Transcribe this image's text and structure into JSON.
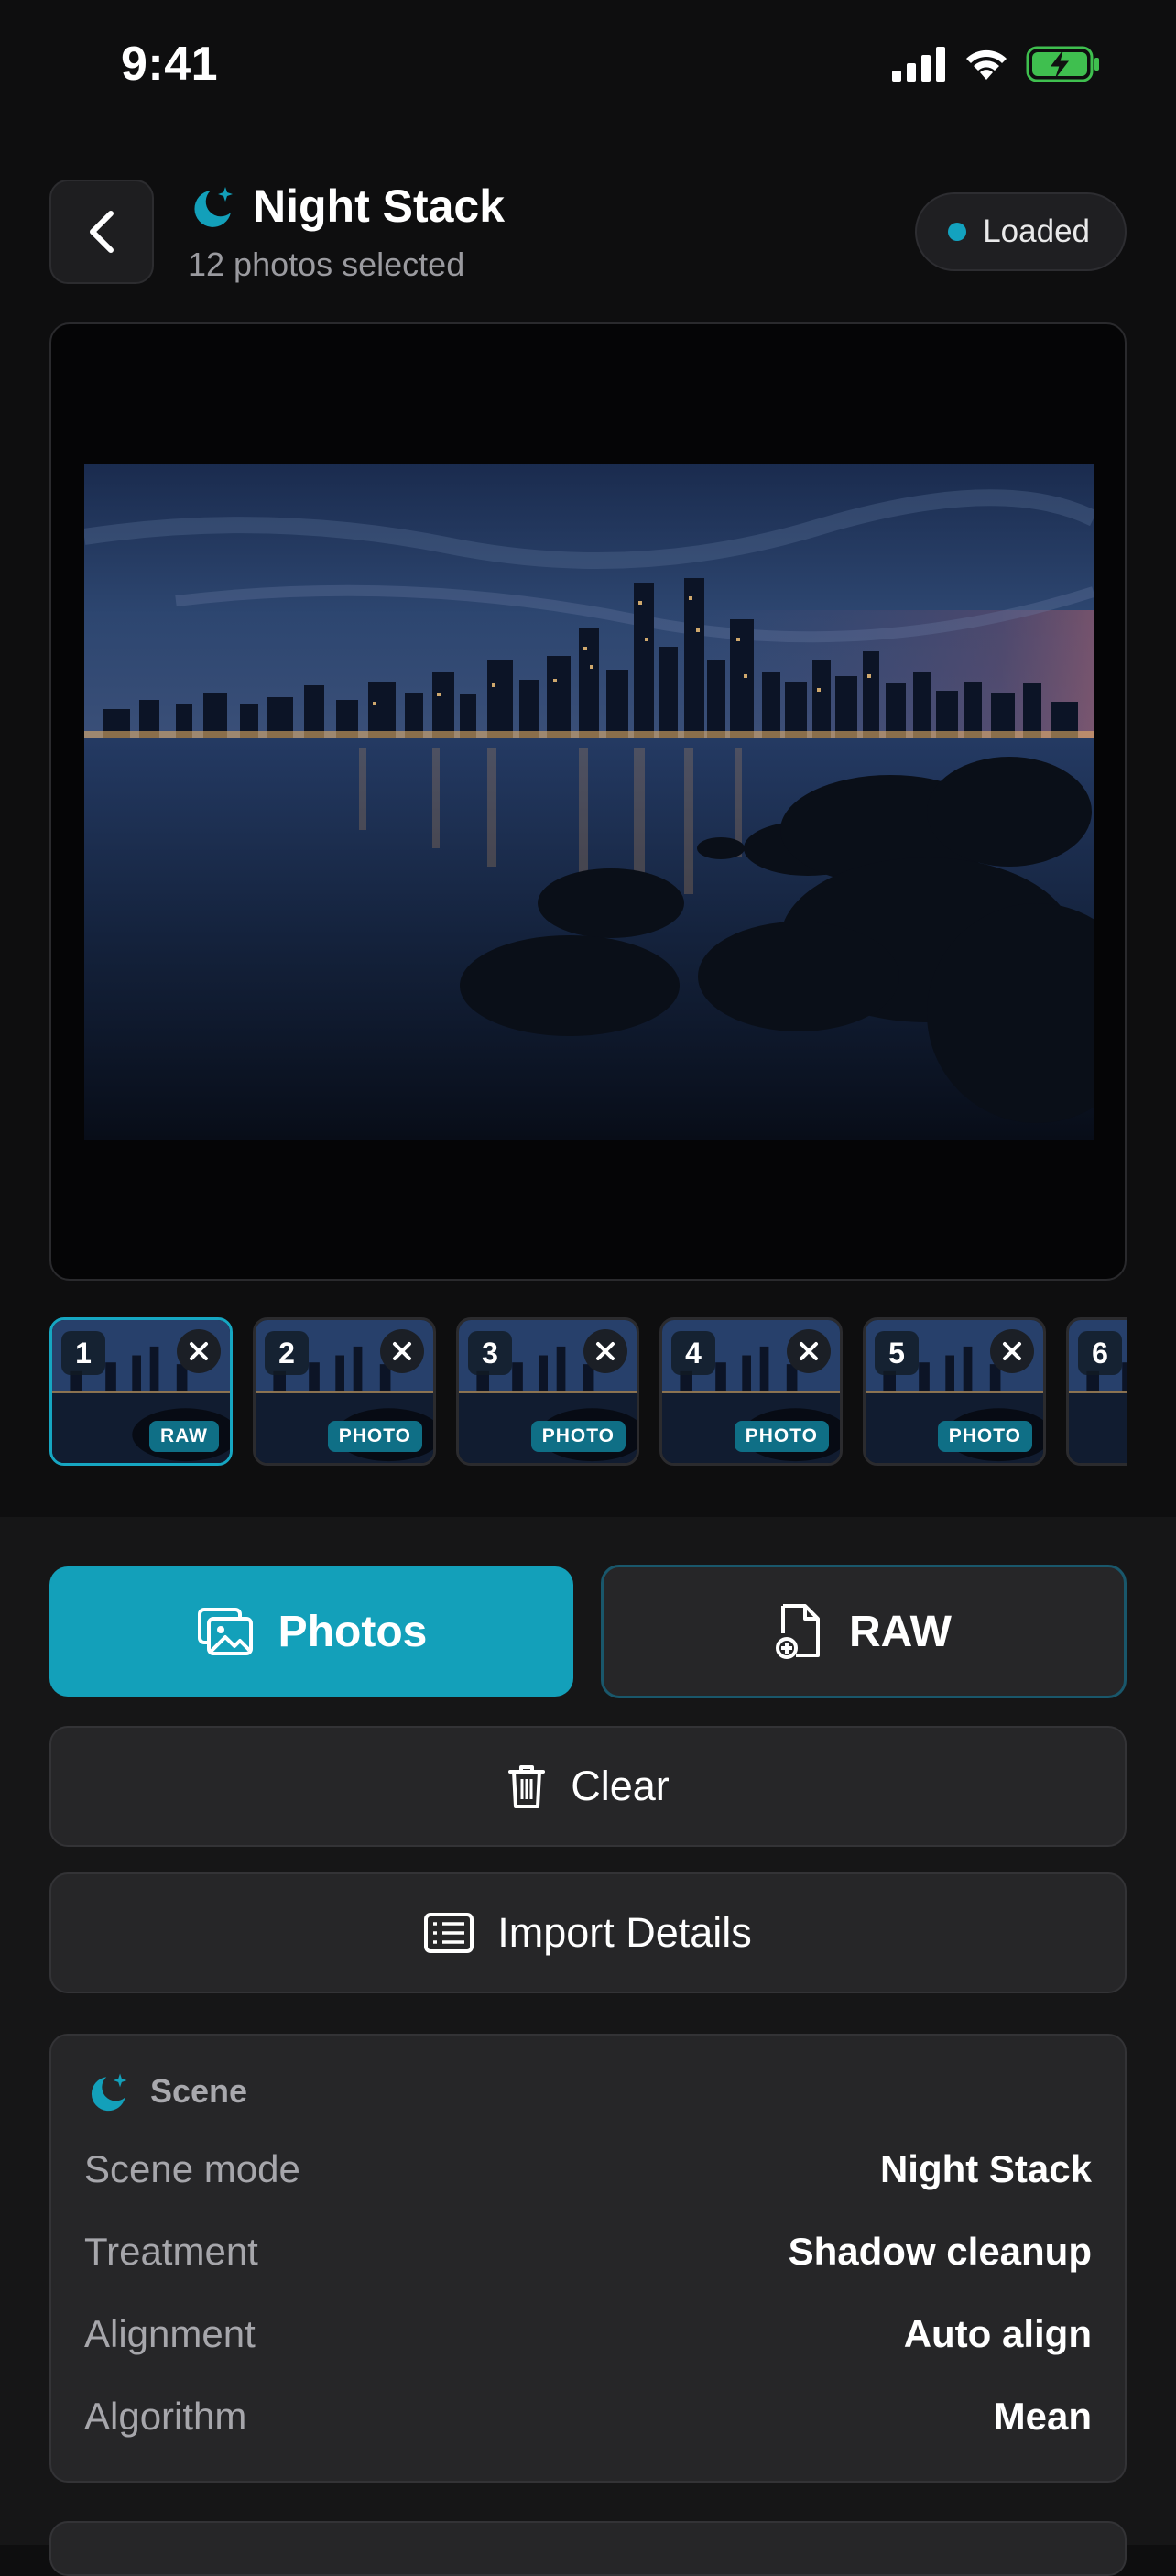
{
  "status_bar": {
    "time": "9:41"
  },
  "header": {
    "title": "Night Stack",
    "subtitle": "12 photos selected",
    "status_label": "Loaded"
  },
  "thumbnails": [
    {
      "num": "1",
      "badge": "RAW"
    },
    {
      "num": "2",
      "badge": "PHOTO"
    },
    {
      "num": "3",
      "badge": "PHOTO"
    },
    {
      "num": "4",
      "badge": "PHOTO"
    },
    {
      "num": "5",
      "badge": "PHOTO"
    },
    {
      "num": "6",
      "badge": ""
    }
  ],
  "actions": {
    "photos_label": "Photos",
    "raw_label": "RAW",
    "clear_label": "Clear",
    "import_label": "Import Details"
  },
  "scene": {
    "title": "Scene",
    "rows": [
      {
        "key": "Scene mode",
        "value": "Night Stack"
      },
      {
        "key": "Treatment",
        "value": "Shadow cleanup"
      },
      {
        "key": "Alignment",
        "value": "Auto align"
      },
      {
        "key": "Algorithm",
        "value": "Mean"
      }
    ]
  },
  "colors": {
    "accent": "#13a0ba",
    "background": "#0e0e0f",
    "card": "#262628"
  }
}
